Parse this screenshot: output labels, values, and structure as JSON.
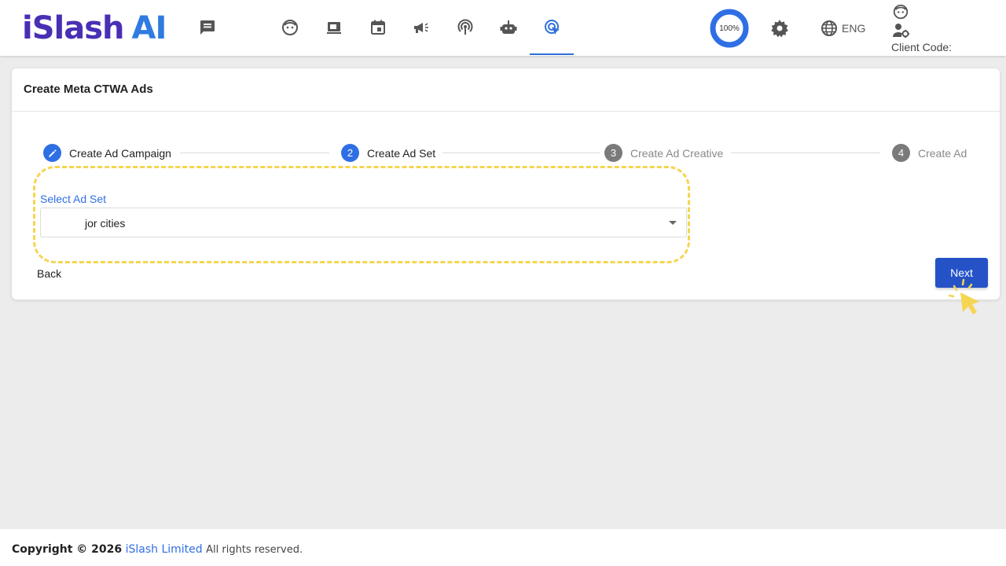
{
  "header": {
    "logo_part1": "iSlash",
    "logo_part2": "AI",
    "nav_icons": [
      "chat-icon",
      "face-icon",
      "media-icon",
      "calendar-icon",
      "megaphone-icon",
      "broadcast-icon",
      "robot-icon",
      "click-target-icon"
    ],
    "active_nav": "click-target-icon",
    "progress_label": "100%",
    "progress_value": 1.0,
    "language": "ENG",
    "client_code_label": "Client Code:"
  },
  "card": {
    "title": "Create Meta CTWA Ads",
    "steps": [
      {
        "number": "",
        "label": "Create Ad Campaign",
        "state": "completed"
      },
      {
        "number": "2",
        "label": "Create Ad Set",
        "state": "active"
      },
      {
        "number": "3",
        "label": "Create Ad Creative",
        "state": "pending"
      },
      {
        "number": "4",
        "label": "Create Ad",
        "state": "pending"
      }
    ],
    "select_label": "Select Ad Set",
    "select_value": "jor cities",
    "back_label": "Back",
    "next_label": "Next"
  },
  "footer": {
    "copyright": "Copyright © 2026",
    "company": "iSlash Limited",
    "rights": "All rights reserved."
  },
  "colors": {
    "accent": "#2f6fe4",
    "primary_button": "#2553c7",
    "highlight": "#f5d551",
    "logo_purple": "#4a2fb5"
  }
}
